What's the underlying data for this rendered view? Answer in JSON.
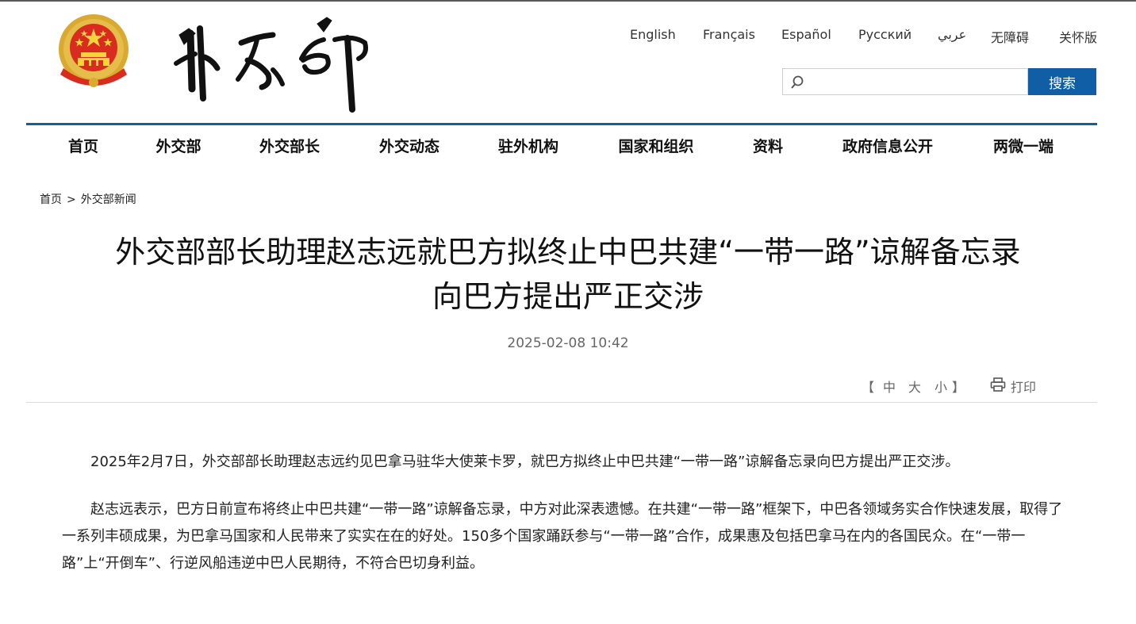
{
  "header": {
    "emblem_icon": "national-emblem-icon",
    "logo_icon": "ministry-calligraphy-logo-icon",
    "languages": [
      "English",
      "Français",
      "Español",
      "Русский",
      "عربي",
      "无障碍",
      "关怀版"
    ],
    "search": {
      "placeholder": "",
      "button_label": "搜索",
      "icon": "search-icon"
    },
    "accent_color": "#0f5ea6"
  },
  "nav": {
    "items": [
      "首页",
      "外交部",
      "外交部长",
      "外交动态",
      "驻外机构",
      "国家和组织",
      "资料",
      "政府信息公开",
      "两微一端"
    ]
  },
  "breadcrumb": {
    "home": "首页",
    "separator": ">",
    "current": "外交部新闻"
  },
  "article": {
    "title_line1": "外交部部长助理赵志远就巴方拟终止中巴共建“一带一路”谅解备忘录",
    "title_line2": "向巴方提出严正交涉",
    "datetime": "2025-02-08 10:42",
    "font_size_controls": {
      "open": "【",
      "large": "中",
      "medium": "大",
      "small": "小",
      "close": "】"
    },
    "print_label": "打印",
    "print_icon": "printer-icon",
    "paragraphs": [
      "2025年2月7日，外交部部长助理赵志远约见巴拿马驻华大使莱卡罗，就巴方拟终止中巴共建“一带一路”谅解备忘录向巴方提出严正交涉。",
      "赵志远表示，巴方日前宣布将终止中巴共建“一带一路”谅解备忘录，中方对此深表遗憾。在共建“一带一路”框架下，中巴各领域务实合作快速发展，取得了一系列丰硕成果，为巴拿马国家和人民带来了实实在在的好处。150多个国家踊跃参与“一带一路”合作，成果惠及包括巴拿马在内的各国民众。在“一带一路”上“开倒车”、行逆风船违逆中巴人民期待，不符合巴切身利益。"
    ]
  }
}
